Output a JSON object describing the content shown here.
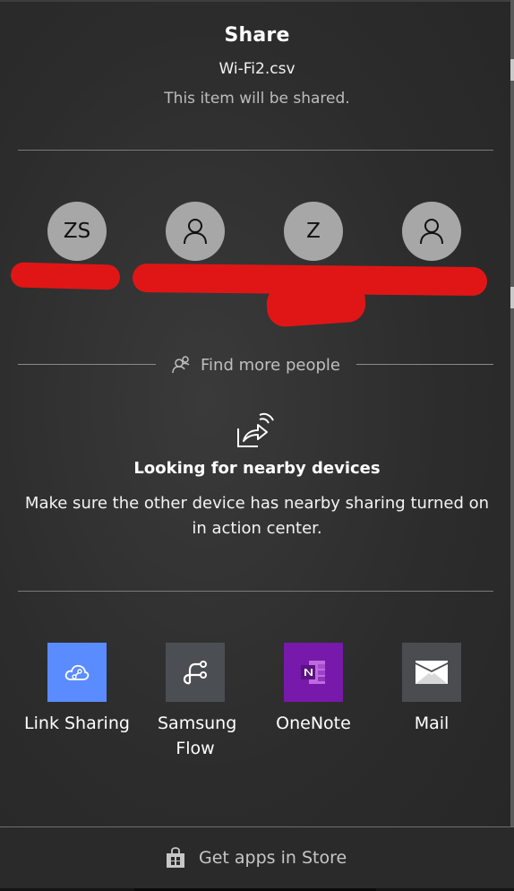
{
  "header": {
    "title": "Share",
    "filename": "Wi-Fi2.csv",
    "subtitle": "This item will be shared."
  },
  "contacts": [
    {
      "initials": "ZS",
      "icon": ""
    },
    {
      "initials": "",
      "icon": "person-icon"
    },
    {
      "initials": "Z",
      "icon": ""
    },
    {
      "initials": "",
      "icon": "person-icon"
    }
  ],
  "find_more": {
    "label": "Find more people",
    "icon": "people-search-icon"
  },
  "nearby": {
    "icon": "nearby-share-icon",
    "title": "Looking for nearby devices",
    "description": "Make sure the other device has nearby sharing turned on in action center."
  },
  "apps": [
    {
      "label": "Link Sharing",
      "icon": "cloud-link-icon",
      "color": "#5b8cff"
    },
    {
      "label": "Samsung Flow",
      "icon": "flow-icon",
      "color": "#4b4f53"
    },
    {
      "label": "OneNote",
      "icon": "onenote-icon",
      "color": "#7719aa"
    },
    {
      "label": "Mail",
      "icon": "mail-icon",
      "color": "#4a4c50"
    }
  ],
  "store": {
    "label": "Get apps in Store",
    "icon": "store-bag-icon"
  },
  "colors": {
    "redaction": "#e01616",
    "avatar": "#a7a7a7"
  }
}
